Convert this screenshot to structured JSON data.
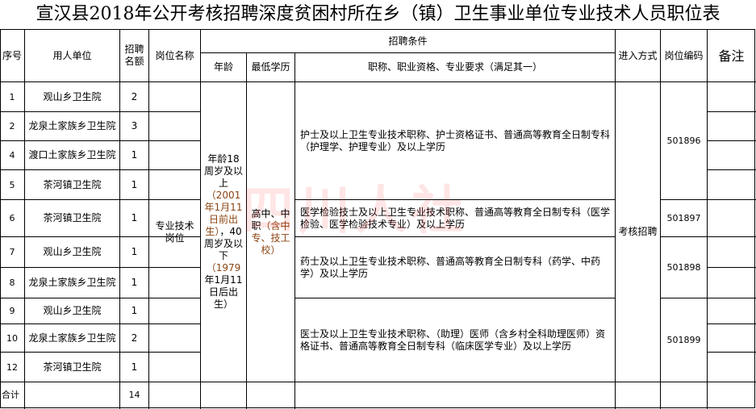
{
  "title": "宣汉县2018年公开考核招聘深度贫困村所在乡（镇）卫生事业单位专业技术人员职位表",
  "headers": {
    "seq": "序号",
    "unit": "用人单位",
    "count": "招聘名额",
    "post": "岗位名称",
    "conditions": "招聘条件",
    "age": "年龄",
    "edu": "最低学历",
    "qual": "职称、职业资格、专业要求（满足其一）",
    "method": "进入方式",
    "code": "岗位编码",
    "remark": "备注"
  },
  "rows": [
    {
      "seq": "1",
      "unit": "观山乡卫生院",
      "count": "2"
    },
    {
      "seq": "2",
      "unit": "龙泉土家族乡卫生院",
      "count": "3"
    },
    {
      "seq": "4",
      "unit": "渡口土家族乡卫生院",
      "count": "1"
    },
    {
      "seq": "5",
      "unit": "茶河镇卫生院",
      "count": "1"
    },
    {
      "seq": "6",
      "unit": "茶河镇卫生院",
      "count": "1"
    },
    {
      "seq": "7",
      "unit": "观山乡卫生院",
      "count": "1"
    },
    {
      "seq": "8",
      "unit": "龙泉土家族乡卫生院",
      "count": "1"
    },
    {
      "seq": "9",
      "unit": "观山乡卫生院",
      "count": "1"
    },
    {
      "seq": "10",
      "unit": "龙泉土家族乡卫生院",
      "count": "2"
    },
    {
      "seq": "12",
      "unit": "茶河镇卫生院",
      "count": "1"
    }
  ],
  "total": {
    "label": "合计",
    "count": "14"
  },
  "post_name": "专业技术岗位",
  "age": {
    "p1": "年龄18周岁及以上",
    "p2": "（2001年1月11日前出生）",
    "p3": "，40周岁及以下",
    "p4": "（1979",
    "p5": "年1月11日后出生）"
  },
  "edu": {
    "p1": "高中、中职",
    "p2": "（含中专、技工校）"
  },
  "requirements": [
    "护士及以上卫生专业技术职称、护士资格证书、普通高等教育全日制专科（护理学、护理专业）及以上学历",
    "医学检验技士及以上卫生专业技术职称、普通高等教育全日制专科（医学检验、医学检验技术专业）及以上学历",
    "药士及以上卫生专业技术职称、普通高等教育全日制专科（药学、中药学）及以上学历",
    "医士及以上卫生专业技术职称、（助理）医师（含乡村全科助理医师）资格证书、普通高等教育全日制专科（临床医学专业）及以上学历"
  ],
  "method": "考核招聘",
  "codes": [
    "501896",
    "501897",
    "501898",
    "501899"
  ],
  "watermark": "四川人社",
  "colors": {
    "age_highlight": "#8B4513",
    "grid": "#000000"
  }
}
